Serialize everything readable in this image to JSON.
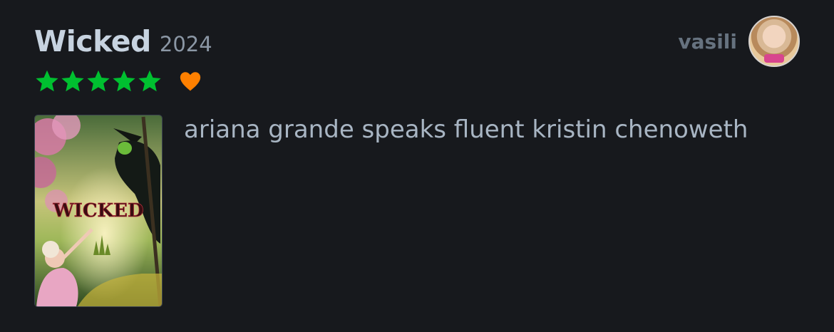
{
  "film": {
    "title": "Wicked",
    "year": "2024",
    "poster_title": "WICKED"
  },
  "rating": {
    "stars": 5,
    "max_stars": 5,
    "liked": true,
    "star_color": "#00c030",
    "heart_color": "#ff8000"
  },
  "user": {
    "username": "vasili"
  },
  "review": {
    "text": "ariana grande speaks fluent kristin chenoweth"
  },
  "icons": {
    "star": "star-icon",
    "heart": "heart-icon"
  }
}
